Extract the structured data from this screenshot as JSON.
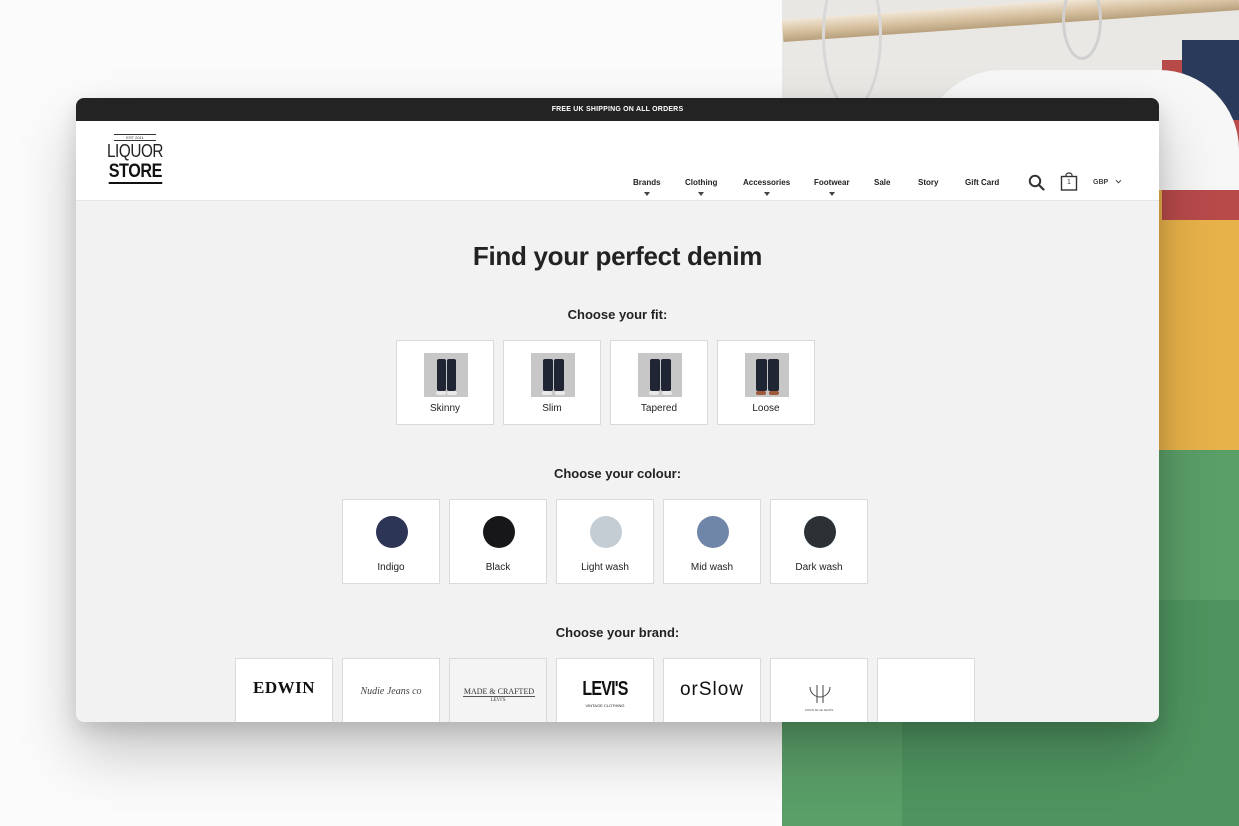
{
  "announcement": "FREE UK SHIPPING ON ALL ORDERS",
  "logo": {
    "small": "EST 2011",
    "top": "LIQUOR",
    "bottom": "STORE"
  },
  "nav": [
    {
      "label": "Brands",
      "dropdown": true
    },
    {
      "label": "Clothing",
      "dropdown": true
    },
    {
      "label": "Accessories",
      "dropdown": true
    },
    {
      "label": "Footwear",
      "dropdown": true
    },
    {
      "label": "Sale",
      "dropdown": false
    },
    {
      "label": "Story",
      "dropdown": false
    },
    {
      "label": "Gift Card",
      "dropdown": false
    }
  ],
  "cart": {
    "count": "1"
  },
  "currency": {
    "value": "GBP"
  },
  "title": "Find your perfect denim",
  "fit": {
    "heading": "Choose your fit:",
    "options": [
      "Skinny",
      "Slim",
      "Tapered",
      "Loose"
    ]
  },
  "colour": {
    "heading": "Choose your colour:",
    "options": [
      {
        "label": "Indigo",
        "color": "#2d3557"
      },
      {
        "label": "Black",
        "color": "#17171a"
      },
      {
        "label": "Light wash",
        "color": "#c3cdd3"
      },
      {
        "label": "Mid wash",
        "color": "#6f86a9"
      },
      {
        "label": "Dark wash",
        "color": "#2b3135"
      }
    ]
  },
  "brand": {
    "heading": "Choose your brand:",
    "options": [
      {
        "logo": "EDWIN"
      },
      {
        "logo": "Nudie Jeans co"
      },
      {
        "logo": "MADE & CRAFTED",
        "sub": "LEVI'S"
      },
      {
        "logo": "LEVI'S",
        "sub": "VINTAGE CLOTHING"
      },
      {
        "logo": "orSlow"
      },
      {
        "logo": "JBJ",
        "sub": "JAPAN BLUE JEANS"
      },
      {
        "logo": ""
      }
    ]
  }
}
